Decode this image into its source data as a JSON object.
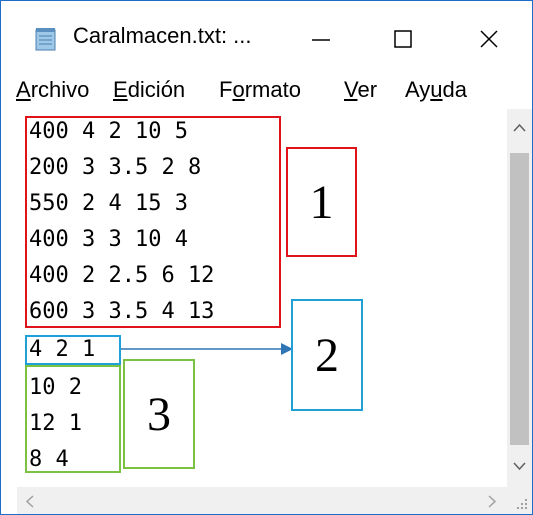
{
  "window": {
    "title": "Caralmacen.txt: ...",
    "controls": {
      "minimize_glyph": "—",
      "maximize_glyph": "☐",
      "close_glyph": "✕"
    }
  },
  "menubar": {
    "items": [
      {
        "label": "Archivo"
      },
      {
        "label": "Edición"
      },
      {
        "label": "Formato"
      },
      {
        "label": "Ver"
      },
      {
        "label": "Ayuda"
      }
    ]
  },
  "editor": {
    "lines": [
      "400 4 2 10 5",
      "200 3 3.5 2 8",
      "550 2 4 15 3",
      "400 3 3 10 4",
      "400 2 2.5 6 12",
      "600 3 3.5 4 13",
      "4 2 1",
      "10 2",
      "12 1",
      "8 4"
    ]
  },
  "annotations": {
    "box1_label": "1",
    "box2_label": "2",
    "box3_label": "3",
    "colors": {
      "red": "#e0121a",
      "blue": "#1fa0d8",
      "green": "#7cc242"
    }
  },
  "scrollbars": {
    "up_arrow": "^",
    "down_arrow": "v",
    "left_arrow": "<",
    "right_arrow": ">"
  }
}
